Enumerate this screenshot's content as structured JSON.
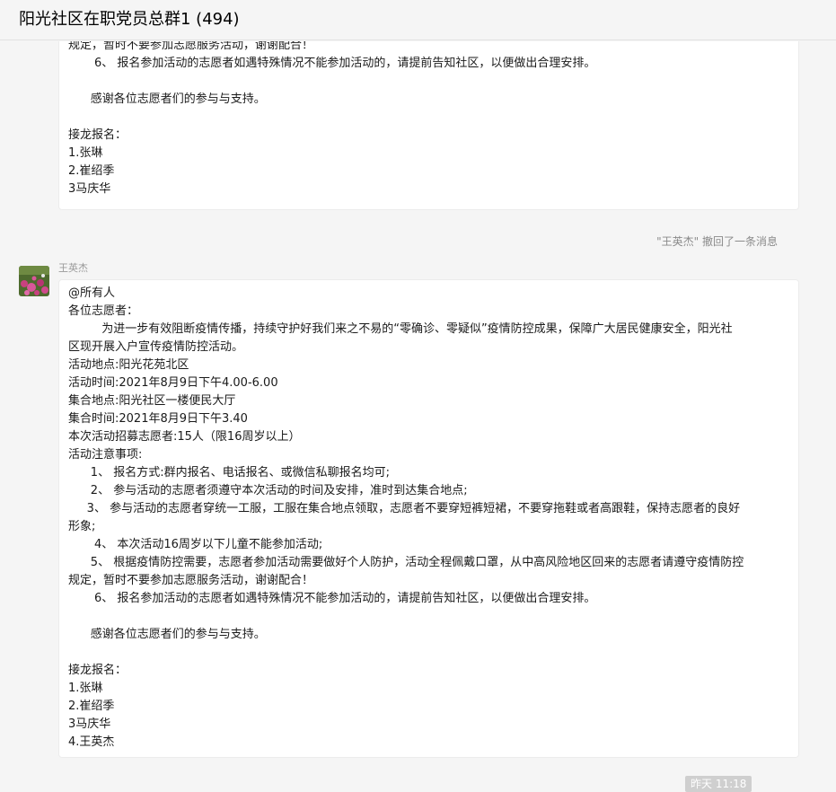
{
  "window": {
    "title": "阳光社区在职党员总群1 (494)"
  },
  "messages": [
    {
      "lines": [
        "规定，暂时不要参加志愿服务活动，谢谢配合！",
        "       6、 报名参加活动的志愿者如遇特殊情况不能参加活动的，请提前告知社区，以便做出合理安排。",
        "",
        "      感谢各位志愿者们的参与与支持。",
        "",
        "接龙报名：",
        "1.张琳",
        "2.崔绍季",
        "3马庆华"
      ]
    },
    {
      "sender": "王英杰",
      "lines": [
        "@所有人",
        "各位志愿者：",
        "         为进一步有效阻断疫情传播，持续守护好我们来之不易的“零确诊、零疑似”疫情防控成果，保障广大居民健康安全，阳光社",
        "区现开展入户宣传疫情防控活动。",
        "活动地点:阳光花苑北区",
        "活动时间:2021年8月9日下午4.00-6.00",
        "集合地点:阳光社区一楼便民大厅",
        "集合时间:2021年8月9日下午3.40",
        "本次活动招募志愿者:15人（限16周岁以上）",
        "活动注意事项:",
        "      1、 报名方式:群内报名、电话报名、或微信私聊报名均可;",
        "      2、 参与活动的志愿者须遵守本次活动的时间及安排，准时到达集合地点;",
        "     3、 参与活动的志愿者穿统一工服，工服在集合地点领取，志愿者不要穿短裤短裙，不要穿拖鞋或者高跟鞋，保持志愿者的良好",
        "形象;",
        "       4、 本次活动16周岁以下儿童不能参加活动;",
        "      5、 根据疫情防控需要，志愿者参加活动需要做好个人防护，活动全程佩戴口罩，从中高风险地区回来的志愿者请遵守疫情防控",
        "规定，暂时不要参加志愿服务活动，谢谢配合！",
        "       6、 报名参加活动的志愿者如遇特殊情况不能参加活动的，请提前告知社区，以便做出合理安排。",
        "",
        "      感谢各位志愿者们的参与与支持。",
        "",
        "接龙报名：",
        "1.张琳",
        "2.崔绍季",
        "3马庆华",
        "4.王英杰"
      ]
    }
  ],
  "system_notice": "\"王英杰\" 撤回了一条消息",
  "timestamp": "昨天 11:18",
  "colors": {
    "background": "#f5f5f5",
    "bubble": "#ffffff",
    "avatar_flowers": "#c8417f",
    "avatar_leaves": "#4e6a2e"
  }
}
